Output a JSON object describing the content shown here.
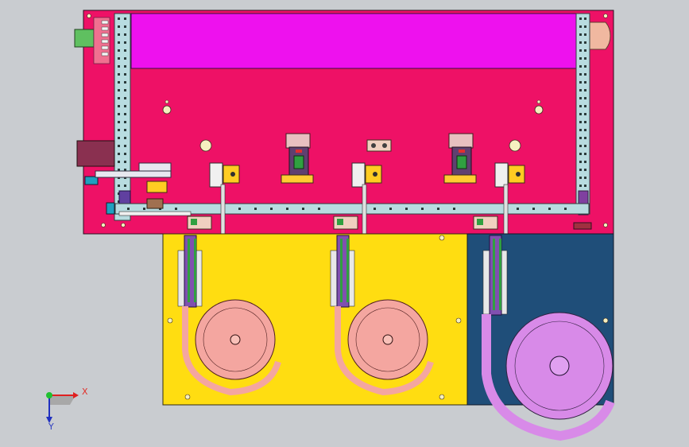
{
  "view": {
    "background": "#c9ccd0",
    "main_plate_color": "#ee1166",
    "top_header_color": "#ee11ee",
    "left_lower_plate_color": "#ffdd11",
    "right_lower_plate_color": "#1f4e79",
    "feeder_bowl_color": "#f4a6a0",
    "large_bowl_color": "#d88ae8",
    "rail_color": "#b8dce0"
  },
  "axis_triad": {
    "x_label": "X",
    "y_label": "Y"
  },
  "feeder_bowls": [
    {
      "name": "left-feeder-bowl"
    },
    {
      "name": "center-feeder-bowl"
    },
    {
      "name": "right-feeder-bowl"
    }
  ]
}
